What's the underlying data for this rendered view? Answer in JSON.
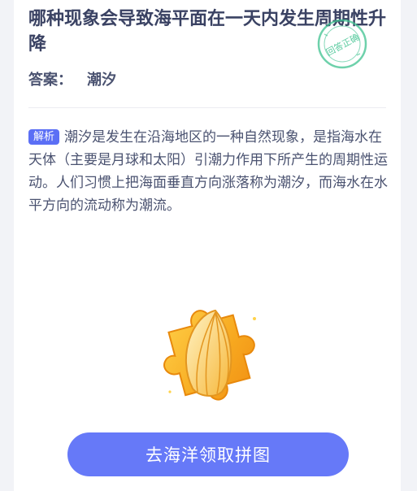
{
  "question": {
    "title": "哪种现象会导致海平面在一天内发生周期性升降"
  },
  "answer": {
    "label": "答案：",
    "value": "潮汐"
  },
  "stamp": {
    "text": "回答正确",
    "color": "#3ec28f"
  },
  "explanation": {
    "badge": "解析",
    "text": "潮汐是发生在沿海地区的一种自然现象，是指海水在天体（主要是月球和太阳）引潮力作用下所产生的周期性运动。人们习惯上把海面垂直方向涨落称为潮汐，而海水在水平方向的流动称为潮流。"
  },
  "reward": {
    "icon": "puzzle-piece-seashell-icon"
  },
  "cta": {
    "label": "去海洋领取拼图",
    "color": "#6679f8"
  }
}
